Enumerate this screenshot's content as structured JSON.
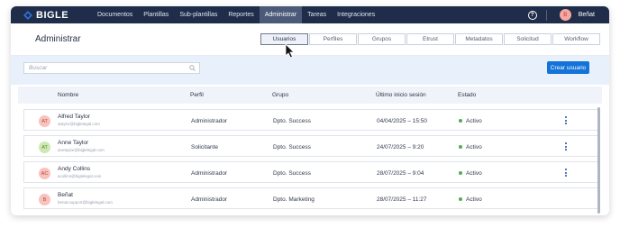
{
  "app": {
    "logo_text": "BIGLE",
    "logo_color": "#2e6fd6"
  },
  "nav": {
    "items": [
      "Documentos",
      "Plantillas",
      "Sub-plantillas",
      "Reportes",
      "Administrar",
      "Tareas",
      "Integraciones"
    ],
    "active": "Administrar"
  },
  "user": {
    "initial": "B",
    "name": "Beñat",
    "help_glyph": "?"
  },
  "page": {
    "title": "Administrar"
  },
  "tabs": [
    "Usuarios",
    "Perfiles",
    "Grupos",
    "Etrust",
    "Metadatos",
    "Solicitud",
    "Workflow"
  ],
  "active_tab": "Usuarios",
  "search": {
    "placeholder": "Buscar"
  },
  "create_button": "Crear usuario",
  "table": {
    "columns": [
      "Nombre",
      "Perfil",
      "Grupo",
      "Último inicio sesión",
      "Estado"
    ],
    "rows": [
      {
        "initials": "AT",
        "name": "Alfred Taylor",
        "email": "ataylor@biglelegal.com",
        "profile": "Administrador",
        "group": "Dpto. Success",
        "last_login": "04/04/2025 – 15:50",
        "status": "Activo",
        "avatar_bg": "#f8c2bd",
        "avatar_fg": "#c0453c"
      },
      {
        "initials": "AT",
        "name": "Anne Taylor",
        "email": "anetaylor@biglelegal.com",
        "profile": "Solicitante",
        "group": "Dpto. Success",
        "last_login": "24/07/2025 – 9:20",
        "status": "Activo",
        "avatar_bg": "#cfe8b4",
        "avatar_fg": "#4f8a2a"
      },
      {
        "initials": "AC",
        "name": "Andy Collins",
        "email": "acollins@biglelegal.com",
        "profile": "Administrador",
        "group": "Dpto. Success",
        "last_login": "28/07/2025 – 9:04",
        "status": "Activo",
        "avatar_bg": "#f8c2bd",
        "avatar_fg": "#c0453c"
      },
      {
        "initials": "B",
        "name": "Beñat",
        "email": "benat.support@biglelegal.com",
        "profile": "Administrador",
        "group": "Dpto. Marketing",
        "last_login": "28/07/2025 – 11:27",
        "status": "Activo",
        "avatar_bg": "#f8c2bd",
        "avatar_fg": "#c0453c"
      }
    ]
  },
  "status_color": "#4caf50",
  "accent": "#1373d8"
}
